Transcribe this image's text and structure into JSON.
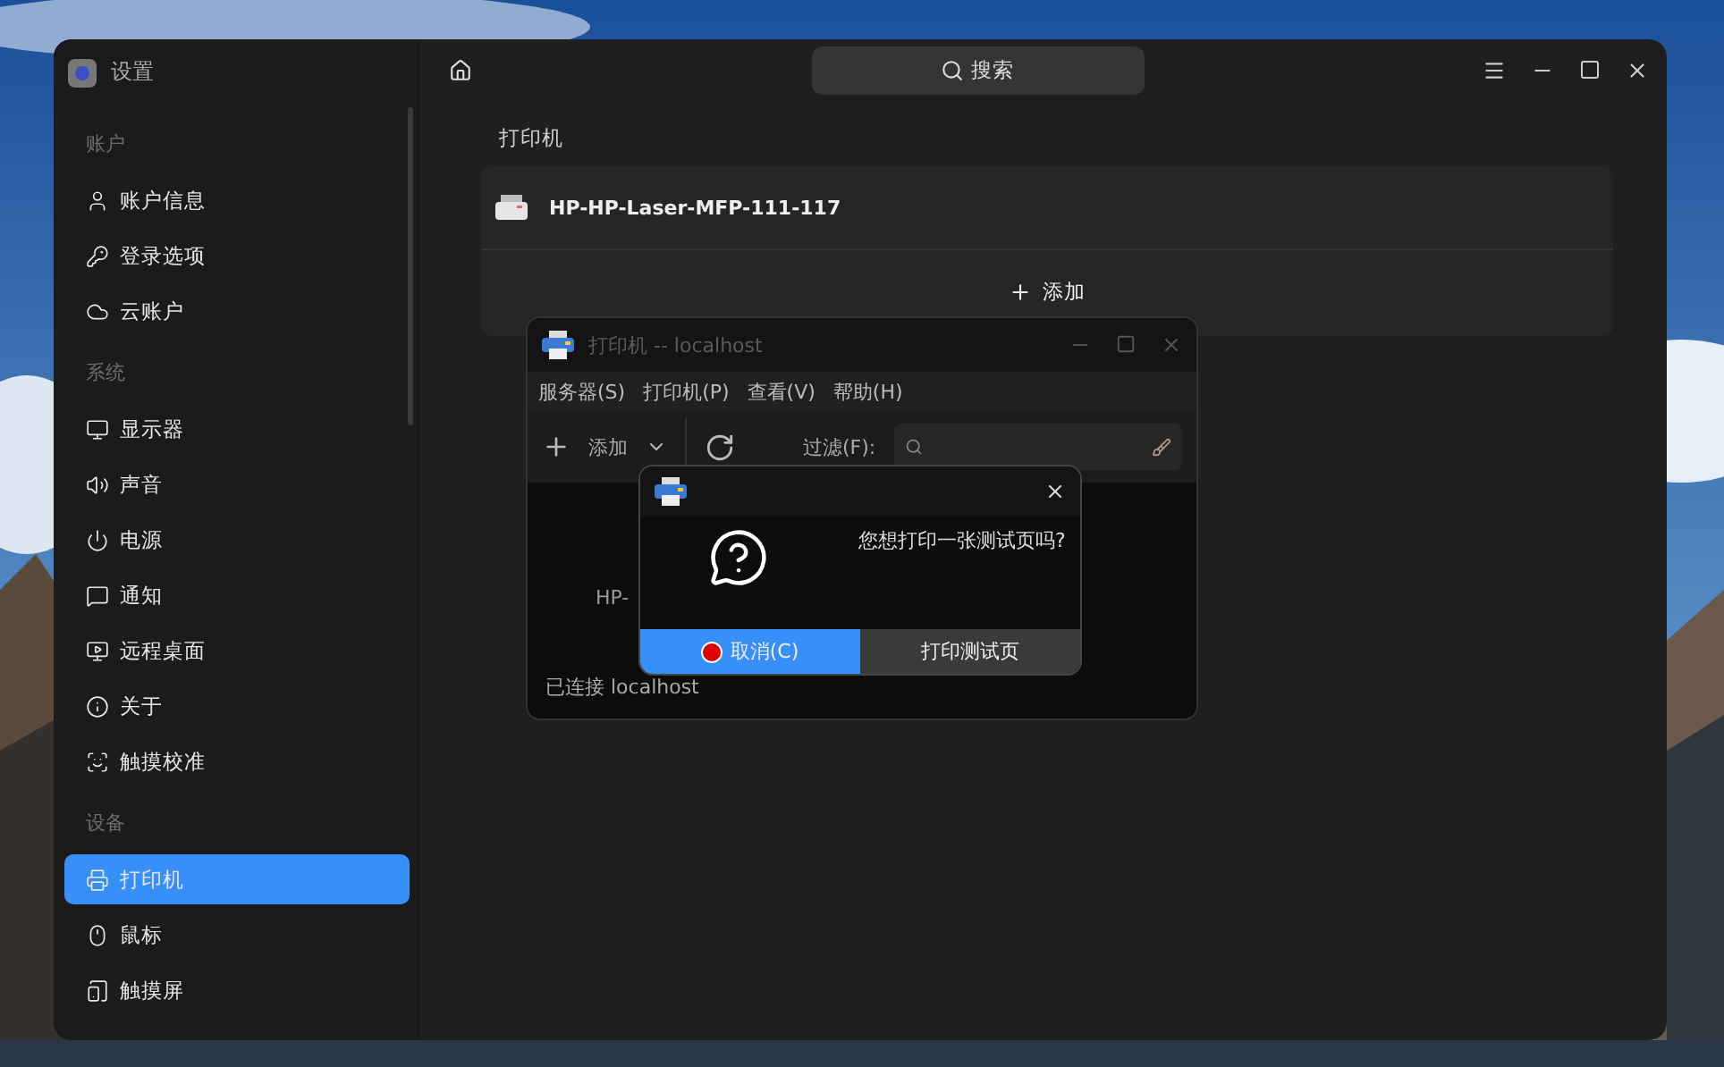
{
  "settings": {
    "title": "设置",
    "search": {
      "placeholder": "搜索"
    },
    "sidebar": [
      {
        "heading": "账户",
        "items": [
          {
            "label": "账户信息",
            "selected": false
          },
          {
            "label": "登录选项",
            "selected": false
          },
          {
            "label": "云账户",
            "selected": false
          }
        ]
      },
      {
        "heading": "系统",
        "items": [
          {
            "label": "显示器",
            "selected": false
          },
          {
            "label": "声音",
            "selected": false
          },
          {
            "label": "电源",
            "selected": false
          },
          {
            "label": "通知",
            "selected": false
          },
          {
            "label": "远程桌面",
            "selected": false
          },
          {
            "label": "关于",
            "selected": false
          },
          {
            "label": "触摸校准",
            "selected": false
          }
        ]
      },
      {
        "heading": "设备",
        "items": [
          {
            "label": "打印机",
            "selected": true
          },
          {
            "label": "鼠标",
            "selected": false
          },
          {
            "label": "触摸屏",
            "selected": false
          }
        ]
      }
    ],
    "page_title": "打印机",
    "printers": [
      {
        "name": "HP-HP-Laser-MFP-111-117"
      }
    ],
    "add_button": "添加"
  },
  "printer_window": {
    "title": "打印机 -- localhost",
    "menu": [
      "服务器(S)",
      "打印机(P)",
      "查看(V)",
      "帮助(H)"
    ],
    "add_button": "添加",
    "filter_label": "过滤(F):",
    "printer_label": "HP-",
    "status": "已连接 localhost"
  },
  "dialog": {
    "message": "您想打印一张测试页吗?",
    "buttons": [
      {
        "label": "取消(C)",
        "selected": true
      },
      {
        "label": "打印测试页",
        "selected": false
      }
    ]
  }
}
